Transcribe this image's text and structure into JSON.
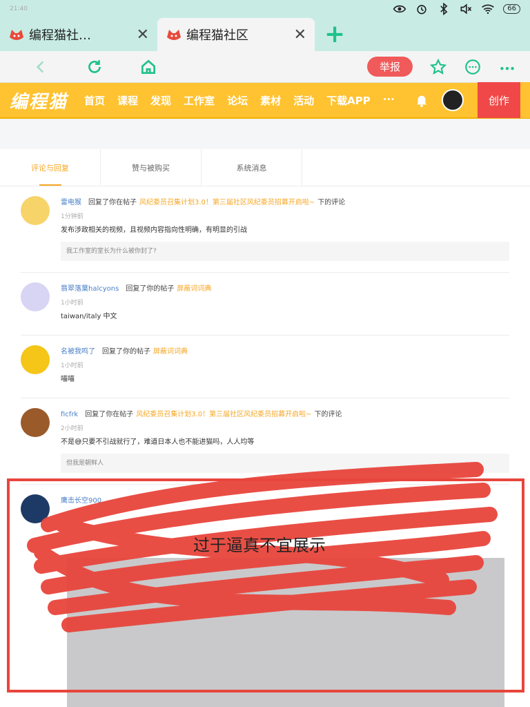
{
  "status": {
    "time": "21:40",
    "battery": "66"
  },
  "tabs": [
    {
      "title": "编程猫社…",
      "close": "✕"
    },
    {
      "title": "编程猫社区",
      "close": "✕"
    }
  ],
  "new_tab": "+",
  "toolbar": {
    "report_label": "举报"
  },
  "site": {
    "logo": "编程猫",
    "menu": [
      "首页",
      "课程",
      "发现",
      "工作室",
      "论坛",
      "素材",
      "活动",
      "下载APP",
      "···"
    ],
    "create_label": "创作"
  },
  "message_tabs": [
    "评论与回复",
    "赞与被购买",
    "系统消息"
  ],
  "messages": [
    {
      "user": "雷电猴",
      "action": "回复了你在帖子",
      "post": "风纪委员召集计划3.0！第三届社区风纪委员招募开启啦~",
      "suffix": "下的评论",
      "time": "1分钟前",
      "content": "发布涉政相关的视频，且视频内容指向性明确，有明显的引战",
      "quote": "我工作室的室长为什么被你封了?"
    },
    {
      "user": "翡翠落葉halcyons",
      "action": "回复了你的帖子",
      "post": "屏蔽词词典",
      "suffix": "",
      "time": "1小时前",
      "content": "taiwan/italy 中文",
      "quote": ""
    },
    {
      "user": "名被我鸣了",
      "action": "回复了你的帖子",
      "post": "屏蔽词词典",
      "suffix": "",
      "time": "1小时前",
      "content": "喵喵",
      "quote": ""
    },
    {
      "user": "ficfrk",
      "action": "回复了你在帖子",
      "post": "风纪委员召集计划3.0！第三届社区风纪委员招募开启啦~",
      "suffix": "下的评论",
      "time": "2小时前",
      "content": "不是😅只要不引战就行了，难道日本人也不能进猫吗，人人均等",
      "quote": "但我是朝鲜人"
    },
    {
      "user": "鹰击长空900",
      "action": "",
      "post": "",
      "suffix": "",
      "time": "",
      "content": "",
      "quote": ""
    }
  ],
  "censor_note": "过于逼真不宜展示",
  "colors": {
    "accent": "#ffc230",
    "link": "#4a7fc8",
    "highlight": "#f5a623",
    "danger": "#e8453c"
  }
}
